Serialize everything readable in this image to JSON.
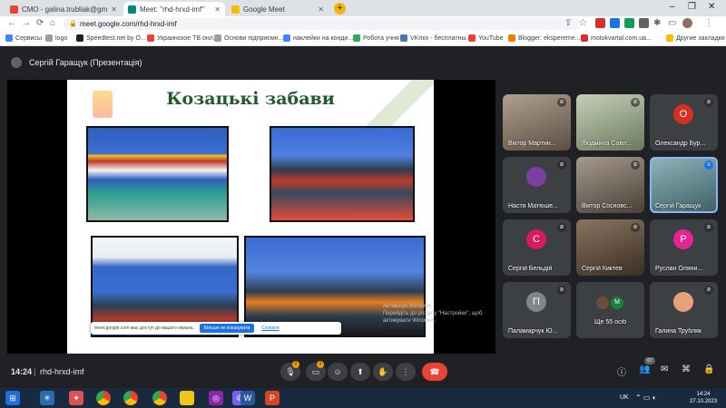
{
  "tabs": [
    {
      "title": "СМО - galina.trubliak@gmail.co",
      "favicon_color": "#ea4335"
    },
    {
      "title": "Meet: \"rhd-hrxd-imf\"",
      "favicon_color": "#00897b"
    },
    {
      "title": "Google Meet",
      "favicon_color": "#fbbc04"
    }
  ],
  "address": {
    "url": "meet.google.com/rhd-hrxd-imf"
  },
  "bookmarks": [
    {
      "label": "Сервисы",
      "color": "#4285f4"
    },
    {
      "label": "logo",
      "color": "#9e9e9e"
    },
    {
      "label": "Speedtest.net by O...",
      "color": "#202124"
    },
    {
      "label": "Украинское ТВ онл...",
      "color": "#ea4335"
    },
    {
      "label": "Основи підприємн...",
      "color": "#9e9e9e"
    },
    {
      "label": "наклейки на конди...",
      "color": "#4285f4"
    },
    {
      "label": "Робота учня",
      "color": "#34a853"
    },
    {
      "label": "VKmix - бесплатны...",
      "color": "#4a76a8"
    },
    {
      "label": "YouTube",
      "color": "#ea4335"
    },
    {
      "label": "Blogger: ekspereme...",
      "color": "#f57c00"
    },
    {
      "label": "motokvartal.com.ua...",
      "color": "#d32f2f"
    },
    {
      "label": "Другие закладки",
      "color": "#fbbc04"
    }
  ],
  "presenter": {
    "name": "Сергій Гаращук (Презентація)"
  },
  "slide": {
    "title": "Козацькі забави"
  },
  "banner": {
    "text": "meet.google.com має доступ до вашого екрана.",
    "button": "Більше не показувати",
    "link": "Сховати"
  },
  "watermark": {
    "line1": "Активація Windows",
    "line2": "Перейдіть до розділу \"Настройки\", щоб",
    "line3": "активувати Windows."
  },
  "participants": [
    {
      "name": "Віктор Мартин...",
      "type": "video",
      "color": "#8d7b6a"
    },
    {
      "name": "Людмила Савл...",
      "type": "video",
      "color": "#9aa58a"
    },
    {
      "name": "Олександр Бур...",
      "type": "avatar",
      "initial": "О",
      "color": "#d93025"
    },
    {
      "name": "Настя Матюше...",
      "type": "avatar-img",
      "color": "#7b3fa0"
    },
    {
      "name": "Віктор Сосновс...",
      "type": "video",
      "color": "#7c7468"
    },
    {
      "name": "Сергій Гаращук",
      "type": "video",
      "color": "#5b8a8f"
    },
    {
      "name": "Сергій Бельдій",
      "type": "avatar",
      "initial": "С",
      "color": "#d81b60"
    },
    {
      "name": "Сергій Киктев",
      "type": "video",
      "color": "#6d5a48"
    },
    {
      "name": "Руслан Оляни...",
      "type": "avatar",
      "initial": "Р",
      "color": "#e52592"
    },
    {
      "name": "Паламарчук Ю...",
      "type": "avatar",
      "initial": "П",
      "color": "#80868b"
    },
    {
      "name": "Ще 55 осіб",
      "type": "more",
      "color": "#3c4043"
    },
    {
      "name": "Галина Трубляк",
      "type": "avatar-img",
      "color": "#e8a07a"
    }
  ],
  "bottom": {
    "time": "14:24",
    "separator": "|",
    "code": "rhd-hrxd-imf",
    "participant_count": "67",
    "mic_badge": "!",
    "cam_badge": "!"
  },
  "taskbar": {
    "lang": "UK",
    "time": "14:24",
    "date": "27.10.2023"
  }
}
